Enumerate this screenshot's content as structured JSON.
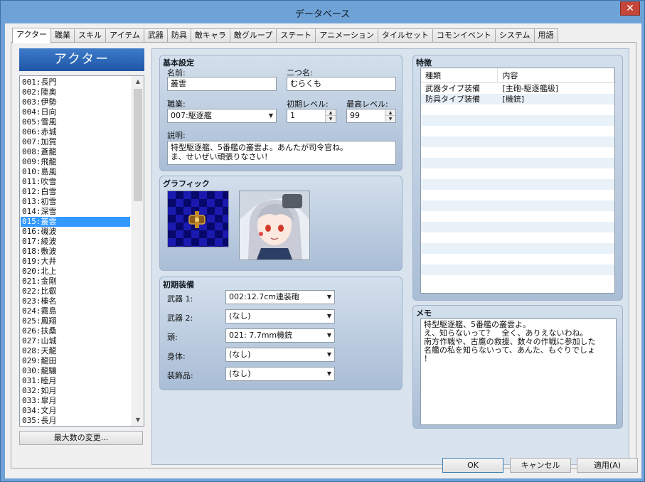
{
  "window": {
    "title": "データベース",
    "close_label": "✕"
  },
  "tabs": [
    {
      "label": "アクター",
      "active": true
    },
    {
      "label": "職業"
    },
    {
      "label": "スキル"
    },
    {
      "label": "アイテム"
    },
    {
      "label": "武器"
    },
    {
      "label": "防具"
    },
    {
      "label": "敵キャラ"
    },
    {
      "label": "敵グループ"
    },
    {
      "label": "ステート"
    },
    {
      "label": "アニメーション"
    },
    {
      "label": "タイルセット"
    },
    {
      "label": "コモンイベント"
    },
    {
      "label": "システム"
    },
    {
      "label": "用語"
    }
  ],
  "sidebar": {
    "header": "アクター",
    "selected_index": 14,
    "actors": [
      "001:長門",
      "002:陸奥",
      "003:伊勢",
      "004:日向",
      "005:雪風",
      "006:赤城",
      "007:加賀",
      "008:蒼龍",
      "009:飛龍",
      "010:島風",
      "011:吹雪",
      "012:白雪",
      "013:初雪",
      "014:深雪",
      "015:叢雲",
      "016:磯波",
      "017:綾波",
      "018:敷波",
      "019:大井",
      "020:北上",
      "021:金剛",
      "022:比叡",
      "023:榛名",
      "024:霧島",
      "025:鳳翔",
      "026:扶桑",
      "027:山城",
      "028:天龍",
      "029:龍田",
      "030:龍驤",
      "031:睦月",
      "032:如月",
      "033:皐月",
      "034:文月",
      "035:長月"
    ],
    "max_button": "最大数の変更..."
  },
  "basic": {
    "title": "基本設定",
    "name_label": "名前:",
    "name_value": "叢雲",
    "nickname_label": "二つ名:",
    "nickname_value": "むらくも",
    "class_label": "職業:",
    "class_value": "007:駆逐艦",
    "init_level_label": "初期レベル:",
    "init_level_value": "1",
    "max_level_label": "最高レベル:",
    "max_level_value": "99",
    "desc_label": "説明:",
    "desc_line1": "特型駆逐艦、5番艦の叢雲よ。あんたが司令官ね。",
    "desc_line2": "ま、せいぜい頑張りなさい！"
  },
  "graphic": {
    "title": "グラフィック"
  },
  "equip": {
    "title": "初期装備",
    "rows": [
      {
        "label": "武器 1:",
        "value": "002:12.7cm連装砲"
      },
      {
        "label": "武器 2:",
        "value": "(なし)"
      },
      {
        "label": "頭:",
        "value": "021: 7.7mm機銃"
      },
      {
        "label": "身体:",
        "value": "(なし)"
      },
      {
        "label": "装飾品:",
        "value": "(なし)"
      }
    ]
  },
  "traits": {
    "title": "特徴",
    "col_type": "種類",
    "col_content": "内容",
    "rows": [
      {
        "type": "武器タイプ装備",
        "content": "[主砲-駆逐艦級]"
      },
      {
        "type": "防具タイプ装備",
        "content": "[機銃]"
      }
    ]
  },
  "memo": {
    "title": "メモ",
    "lines": [
      "特型駆逐艦、5番艦の叢雲よ。",
      "え、知らないって？　全く、ありえないわね。",
      "南方作戦や、古鷹の救援、数々の作戦に参加した",
      "名艦の私を知らないって、あんた、もぐりでしょ",
      "！"
    ]
  },
  "buttons": {
    "ok": "OK",
    "cancel": "キャンセル",
    "apply": "適用(A)"
  },
  "colors": {
    "accent": "#3399ff",
    "header_blue": "#1f56a6",
    "panel": "#a9bdd6"
  }
}
